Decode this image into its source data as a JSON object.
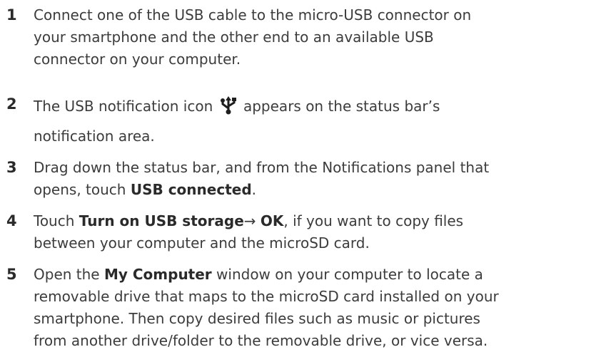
{
  "steps": [
    {
      "number": "1",
      "lines": [
        "Connect one of the USB cable to the micro-USB connector on",
        "your smartphone and the other end to an available USB",
        "connector on your computer."
      ]
    },
    {
      "number": "2",
      "before_icon": "The USB notification icon",
      "icon": "usb-icon",
      "after_icon": "appears on the status bar’s",
      "line2": "notification area."
    },
    {
      "number": "3",
      "line1": "Drag down the status bar, and from the Notifications panel that",
      "line2_pre": "opens, touch ",
      "line2_bold": "USB connected",
      "line2_post": "."
    },
    {
      "number": "4",
      "line1_pre": "Touch ",
      "line1_bold1": "Turn on USB storage",
      "line1_arrow": "→ ",
      "line1_bold2": "OK",
      "line1_post": ", if you want to copy files",
      "line2": "between your computer and the microSD card."
    },
    {
      "number": "5",
      "line1_pre": "Open the ",
      "line1_bold": "My Computer",
      "line1_post": " window on your computer to locate a",
      "lines_rest": [
        "removable drive that maps to the microSD card installed on your",
        "smartphone. Then copy desired files such as music or pictures",
        "from another drive/folder to the removable drive, or vice versa."
      ]
    }
  ]
}
